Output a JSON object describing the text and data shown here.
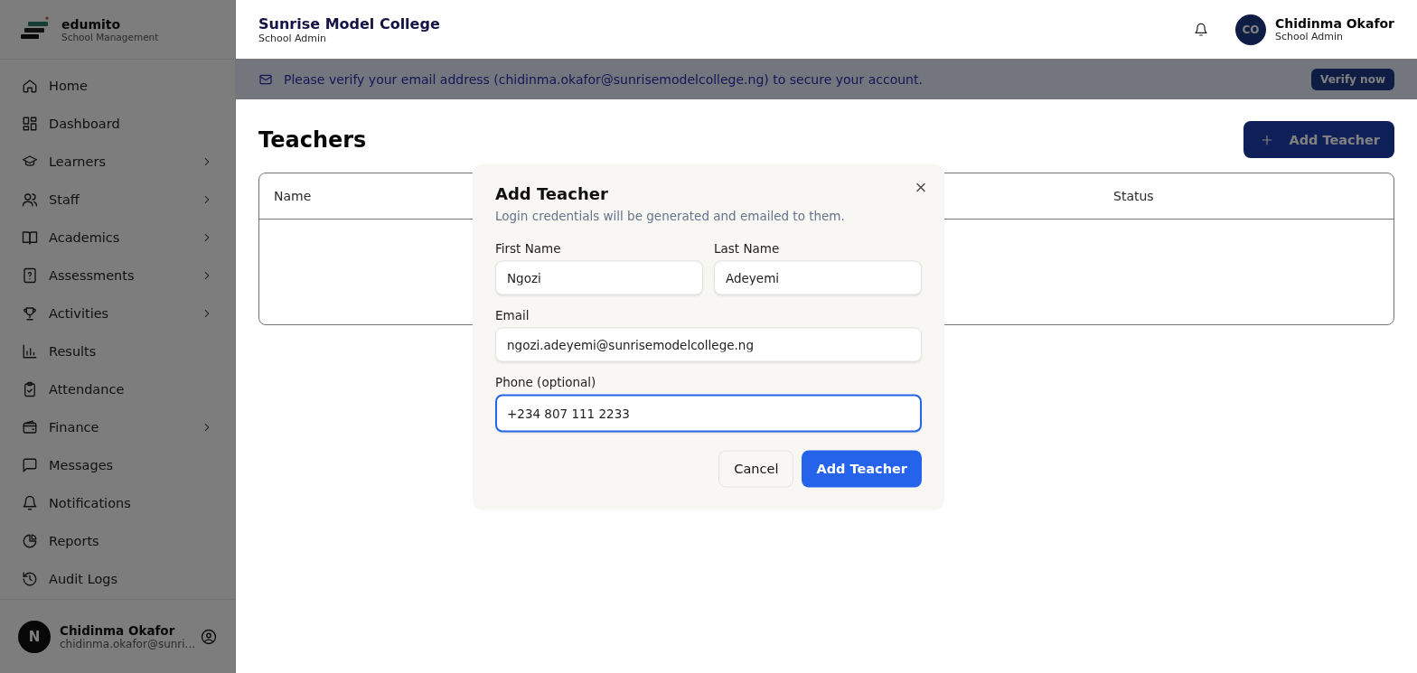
{
  "brand": {
    "name": "edumito",
    "subtitle": "School Management"
  },
  "sidebar": {
    "items": [
      {
        "label": "Home",
        "expandable": false
      },
      {
        "label": "Dashboard",
        "expandable": false
      },
      {
        "label": "Learners",
        "expandable": true
      },
      {
        "label": "Staff",
        "expandable": true
      },
      {
        "label": "Academics",
        "expandable": true
      },
      {
        "label": "Assessments",
        "expandable": true
      },
      {
        "label": "Activities",
        "expandable": true
      },
      {
        "label": "Results",
        "expandable": false
      },
      {
        "label": "Attendance",
        "expandable": false
      },
      {
        "label": "Finance",
        "expandable": true
      },
      {
        "label": "Messages",
        "expandable": false
      },
      {
        "label": "Notifications",
        "expandable": false
      },
      {
        "label": "Reports",
        "expandable": false
      },
      {
        "label": "Audit Logs",
        "expandable": false
      }
    ],
    "user": {
      "avatar": "N",
      "name": "Chidinma Okafor",
      "email": "chidinma.okafor@sunri..."
    }
  },
  "header": {
    "school": "Sunrise Model College",
    "role": "School Admin",
    "user": {
      "initials": "CO",
      "name": "Chidinma Okafor",
      "role": "School Admin"
    }
  },
  "banner": {
    "text": "Please verify your email address (chidinma.okafor@sunrisemodelcollege.ng) to secure your account.",
    "button": "Verify now"
  },
  "page": {
    "title": "Teachers",
    "add_button": "Add Teacher"
  },
  "table": {
    "columns": [
      "Name",
      "Status"
    ]
  },
  "dialog": {
    "title": "Add Teacher",
    "subtitle": "Login credentials will be generated and emailed to them.",
    "fields": [
      {
        "label": "First Name",
        "value": "Ngozi",
        "focused": false
      },
      {
        "label": "Last Name",
        "value": "Adeyemi",
        "focused": false
      },
      {
        "label": "Email",
        "value": "ngozi.adeyemi@sunrisemodelcollege.ng",
        "focused": false
      },
      {
        "label": "Phone (optional)",
        "value": "+234 807 111 2233",
        "focused": true
      }
    ],
    "buttons": [
      {
        "label": "Cancel",
        "kind": "secondary"
      },
      {
        "label": "Add Teacher",
        "kind": "primary"
      }
    ]
  }
}
